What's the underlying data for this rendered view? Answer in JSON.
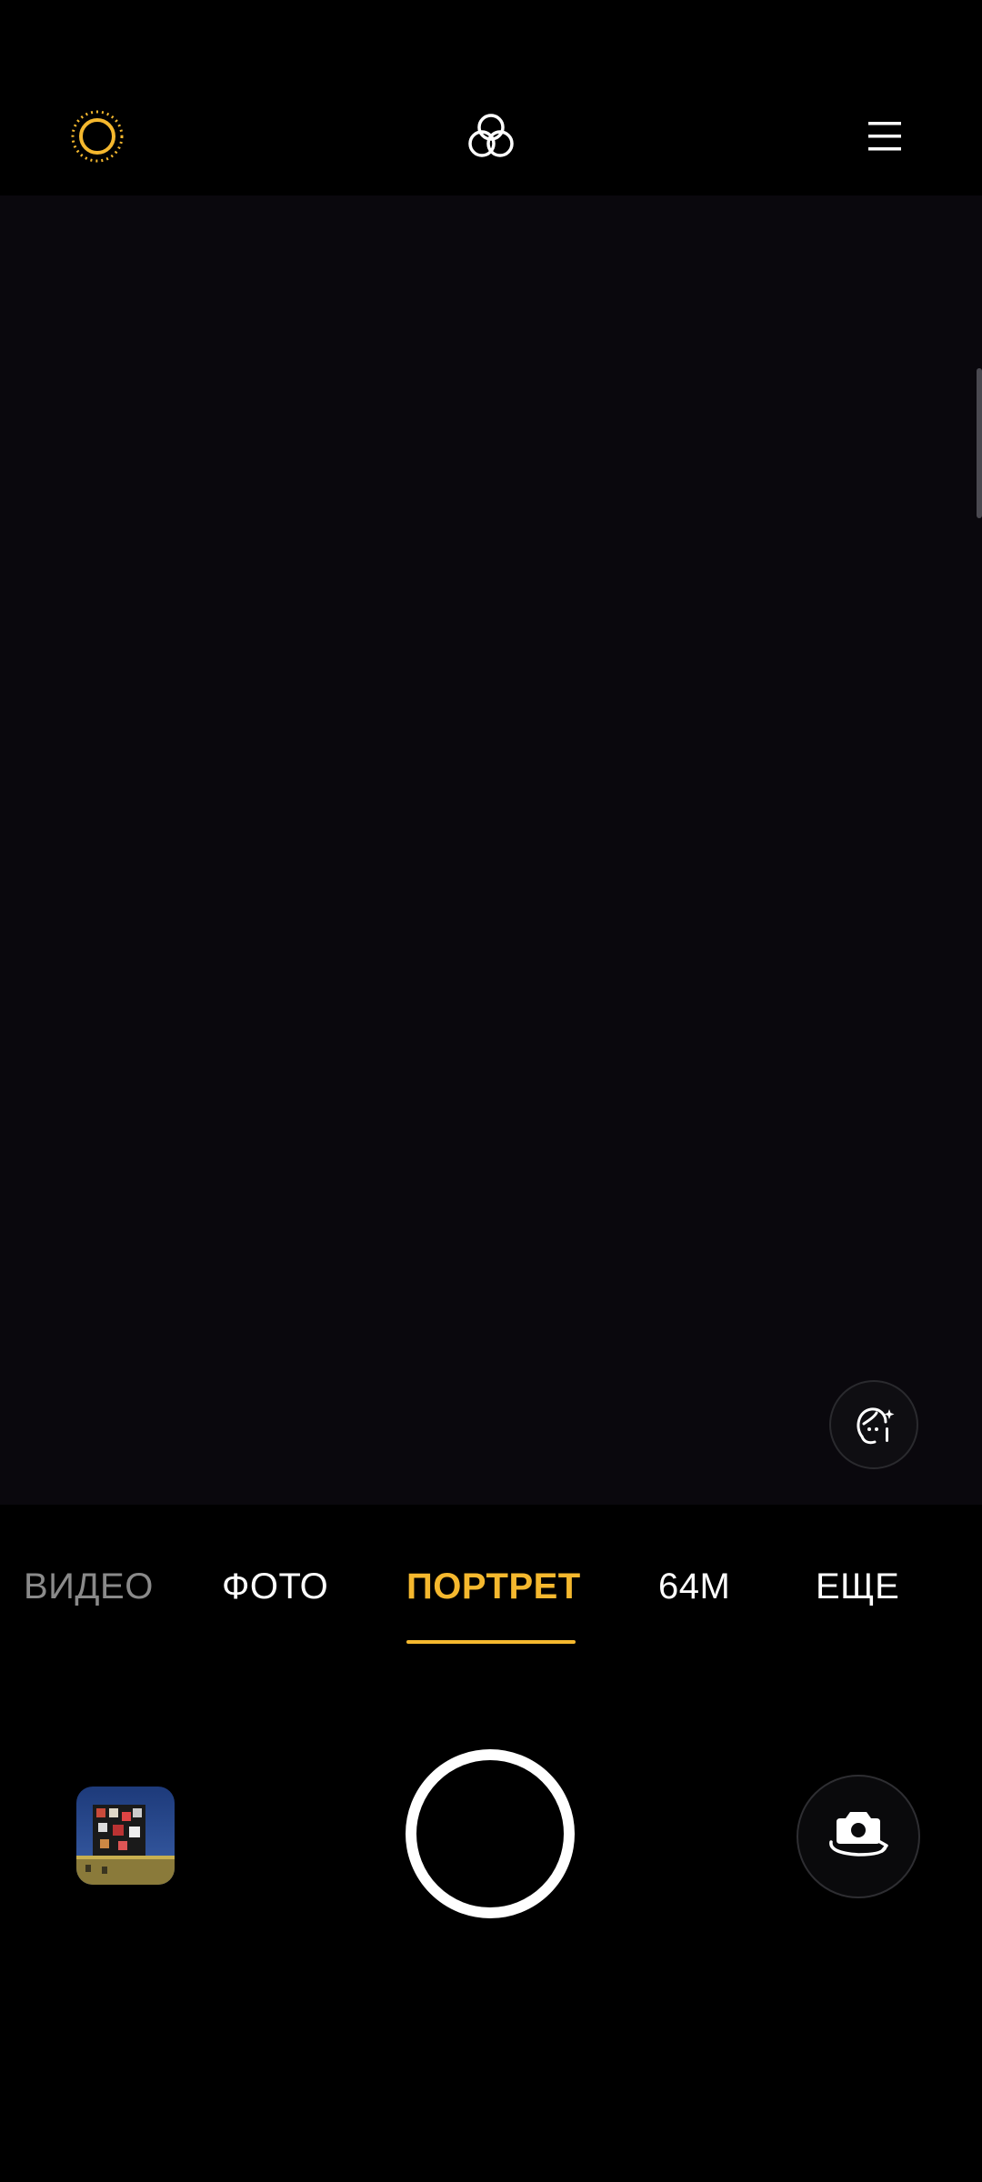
{
  "topbar": {
    "left_icon": "sun-icon",
    "center_icon": "filters-icon",
    "right_icon": "menu-icon",
    "accent_color": "#f5b82e"
  },
  "viewfinder": {
    "beauty_icon": "face-beauty-icon"
  },
  "modes": {
    "items": [
      {
        "id": "video",
        "label": "ВИДЕО"
      },
      {
        "id": "photo",
        "label": "ФОТО"
      },
      {
        "id": "portrait",
        "label": "ПОРТРЕТ",
        "active": true
      },
      {
        "id": "64m",
        "label": "64M"
      },
      {
        "id": "more",
        "label": "ЕЩЕ"
      }
    ],
    "active_color": "#f5b82e"
  },
  "bottom": {
    "gallery_icon": "gallery-thumbnail",
    "shutter_icon": "shutter-button",
    "flip_icon": "camera-flip-icon"
  }
}
